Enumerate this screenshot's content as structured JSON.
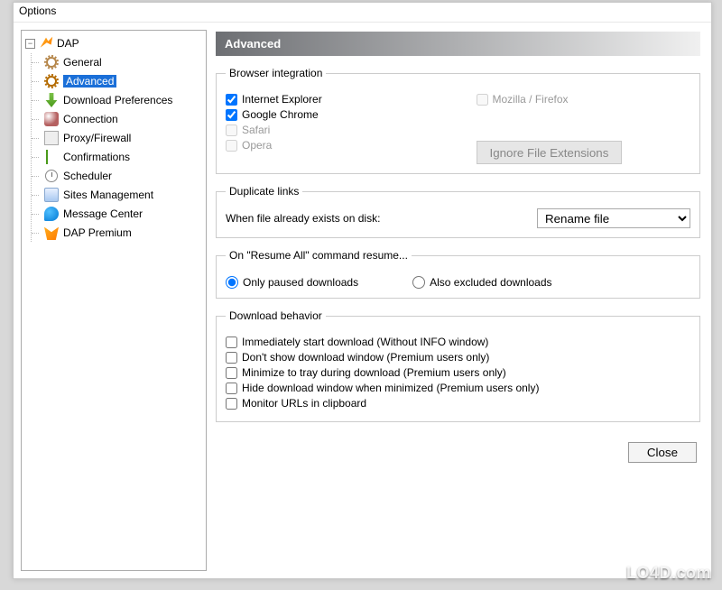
{
  "window": {
    "title": "Options"
  },
  "sidebar": {
    "root_label": "DAP",
    "items": [
      {
        "label": "General"
      },
      {
        "label": "Advanced",
        "selected": true
      },
      {
        "label": "Download Preferences"
      },
      {
        "label": "Connection"
      },
      {
        "label": "Proxy/Firewall"
      },
      {
        "label": "Confirmations"
      },
      {
        "label": "Scheduler"
      },
      {
        "label": "Sites Management"
      },
      {
        "label": "Message Center"
      },
      {
        "label": "DAP Premium"
      }
    ]
  },
  "panel": {
    "title": "Advanced"
  },
  "browser_integration": {
    "legend": "Browser integration",
    "ie": {
      "label": "Internet Explorer",
      "checked": true,
      "enabled": true
    },
    "chrome": {
      "label": "Google Chrome",
      "checked": true,
      "enabled": true
    },
    "safari": {
      "label": "Safari",
      "checked": false,
      "enabled": false
    },
    "opera": {
      "label": "Opera",
      "checked": false,
      "enabled": false
    },
    "mozilla": {
      "label": "Mozilla / Firefox",
      "checked": false,
      "enabled": false
    },
    "ignore_btn": "Ignore File Extensions"
  },
  "duplicate_links": {
    "legend": "Duplicate links",
    "label": "When file already exists on disk:",
    "selected": "Rename file"
  },
  "resume_all": {
    "legend": "On \"Resume All\" command resume...",
    "opt_paused": "Only paused downloads",
    "opt_excluded": "Also excluded downloads",
    "value": "paused"
  },
  "download_behavior": {
    "legend": "Download behavior",
    "items": [
      {
        "label": "Immediately start download (Without INFO window)",
        "checked": false
      },
      {
        "label": "Don't show download window (Premium users only)",
        "checked": false
      },
      {
        "label": "Minimize to tray during download (Premium users only)",
        "checked": false
      },
      {
        "label": "Hide download window when minimized (Premium users only)",
        "checked": false
      },
      {
        "label": "Monitor URLs in clipboard",
        "checked": false
      }
    ]
  },
  "footer": {
    "close": "Close"
  },
  "watermark": "LO4D.com"
}
